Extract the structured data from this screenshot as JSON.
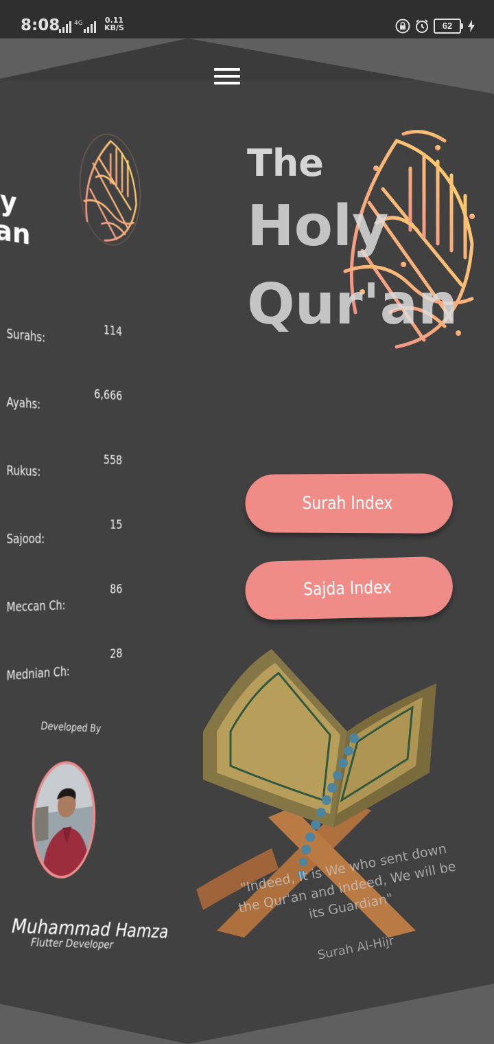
{
  "status_bar": {
    "time": "8:08",
    "network": "4G",
    "speed_value": "0.11",
    "speed_unit": "KB/S",
    "battery": "62",
    "icons": [
      "signal-icon",
      "lock-icon",
      "alarm-icon",
      "battery-icon",
      "charging-icon"
    ]
  },
  "menu": {
    "icon": "hamburger-menu-icon"
  },
  "drawer": {
    "title_line1": "y",
    "title_line2": "r'an",
    "stats": [
      {
        "label": "Surahs:",
        "value": "114"
      },
      {
        "label": "Ayahs:",
        "value": "6,666"
      },
      {
        "label": "Rukus:",
        "value": "558"
      },
      {
        "label": "Sajood:",
        "value": "15"
      },
      {
        "label": "Meccan Ch:",
        "value": "86"
      },
      {
        "label": "Mednian Ch:",
        "value": "28"
      }
    ],
    "developed_by": "Developed By",
    "developer_name": "Muhammad Hamza",
    "developer_role": "Flutter Developer"
  },
  "main": {
    "title_the": "The",
    "title_holy": "Holy",
    "title_quran": "Qur'an",
    "buttons": {
      "surah_index": "Surah Index",
      "sajda_index": "Sajda Index"
    },
    "quote": "\"Indeed, It is We who sent down the Qur'an and indeed, We will be its Guardian\"",
    "quote_source": "Surah Al-Hijr"
  },
  "colors": {
    "background": "#5f5f5f",
    "panel": "#414141",
    "button": "#ef8c87",
    "calligraphy_start": "#ffd86a",
    "calligraphy_end": "#f08a8a"
  }
}
